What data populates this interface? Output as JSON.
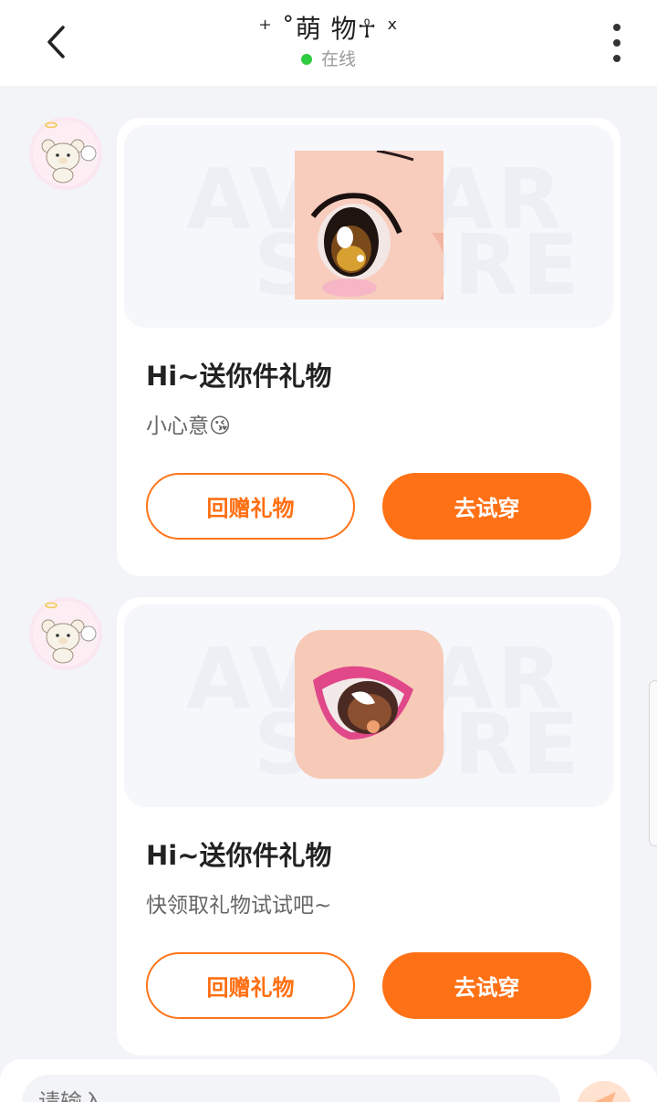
{
  "header": {
    "title": "⁺ ˚萌 物☥ ˣ",
    "status": "在线",
    "status_color": "#2ecc40"
  },
  "messages": [
    {
      "watermark_line1": "AVATAR",
      "watermark_line2": "STORE",
      "title": "Hi~送你件礼物",
      "subtitle": "小心意😘",
      "return_gift_label": "回赠礼物",
      "try_on_label": "去试穿"
    },
    {
      "watermark_line1": "AVATAR",
      "watermark_line2": "STORE",
      "title": "Hi~送你件礼物",
      "subtitle": "快领取礼物试试吧~",
      "return_gift_label": "回赠礼物",
      "try_on_label": "去试穿"
    }
  ],
  "composer": {
    "placeholder": "请输入"
  },
  "colors": {
    "accent": "#ff7116",
    "background": "#f3f4f7"
  }
}
